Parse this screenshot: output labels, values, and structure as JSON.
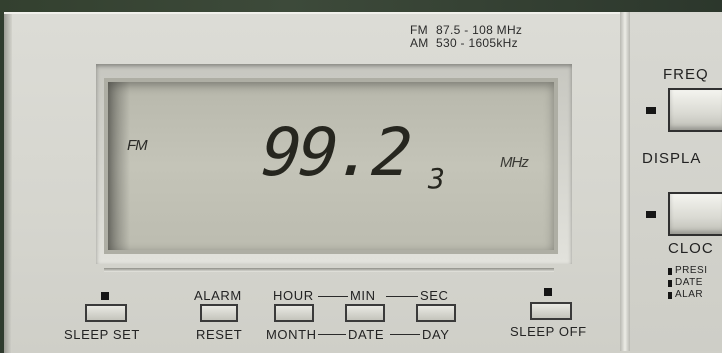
{
  "band_info": {
    "fm_label": "FM",
    "fm_range": "87.5 - 108 MHz",
    "am_label": "AM",
    "am_range": "530 - 1605kHz"
  },
  "display": {
    "band": "FM",
    "frequency": "99.2",
    "sub_digit": "3",
    "unit": "MHz"
  },
  "right_panel": {
    "freq_label": "FREQ",
    "display_label": "DISPLA",
    "clock_label": "CLOC",
    "list": [
      "PRESI",
      "DATE",
      "ALAR"
    ]
  },
  "buttons": {
    "sleep_set": "SLEEP SET",
    "alarm": "ALARM",
    "reset": "RESET",
    "hour": "HOUR",
    "month": "MONTH",
    "min": "MIN",
    "date": "DATE",
    "sec": "SEC",
    "day": "DAY",
    "sleep_off": "SLEEP OFF"
  },
  "colors": {
    "lcd_background": "#c0c0b4",
    "lcd_segment": "#26261f",
    "panel": "#d6d6cf"
  }
}
